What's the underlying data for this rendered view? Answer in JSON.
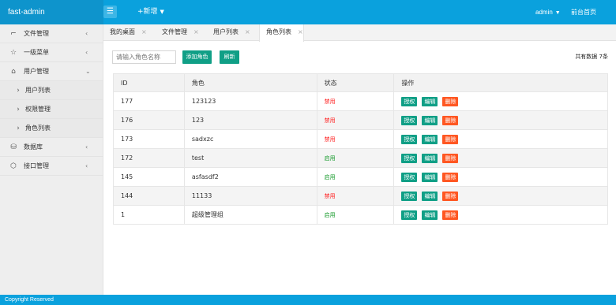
{
  "header": {
    "brand": "fast-admin",
    "menu_icon": "menu-icon",
    "new_label": "+新增",
    "user_label": "admin",
    "home_label": "前台首页"
  },
  "sidebar": {
    "items": [
      {
        "icon": "file-icon",
        "label": "文件管理",
        "arrow": "‹"
      },
      {
        "icon": "star-icon",
        "label": "一级菜单",
        "arrow": "‹"
      },
      {
        "icon": "home-icon",
        "label": "用户管理",
        "arrow": "⌄"
      },
      {
        "icon": "chevron-right-icon",
        "label": "用户列表"
      },
      {
        "icon": "chevron-right-icon",
        "label": "权限管理"
      },
      {
        "icon": "chevron-right-icon",
        "label": "角色列表"
      },
      {
        "icon": "database-icon",
        "label": "数据库",
        "arrow": "‹"
      },
      {
        "icon": "cube-icon",
        "label": "接口管理",
        "arrow": "‹"
      }
    ]
  },
  "tabs": [
    {
      "label": "我的桌面",
      "close": "×"
    },
    {
      "label": "文件管理",
      "close": "×"
    },
    {
      "label": "用户列表",
      "close": "×"
    },
    {
      "label": "角色列表",
      "close": "×"
    }
  ],
  "toolbar": {
    "search_placeholder": "请输入角色名称",
    "add_label": "添加角色",
    "refresh_label": "刷新",
    "total_label": "共有数据 7条"
  },
  "table": {
    "headers": [
      "ID",
      "角色",
      "状态",
      "操作"
    ],
    "rows": [
      {
        "id": "177",
        "role": "123123",
        "status": "禁用",
        "enabled": false
      },
      {
        "id": "176",
        "role": "123",
        "status": "禁用",
        "enabled": false
      },
      {
        "id": "173",
        "role": "sadxzc",
        "status": "禁用",
        "enabled": false
      },
      {
        "id": "172",
        "role": "test",
        "status": "启用",
        "enabled": true
      },
      {
        "id": "145",
        "role": "asfasdf2",
        "status": "启用",
        "enabled": true
      },
      {
        "id": "144",
        "role": "11133",
        "status": "禁用",
        "enabled": false
      },
      {
        "id": "1",
        "role": "超级管理组",
        "status": "启用",
        "enabled": true
      }
    ],
    "actions": {
      "auth": "授权",
      "edit": "编辑",
      "delete": "删除"
    }
  },
  "footer": {
    "text": "Copyright Reserved"
  },
  "colors": {
    "topbar": "#0aa1dd",
    "brand_bg": "#0e94cc",
    "green_button": "#109f86",
    "delete_button": "#ff5722",
    "status_disabled": "#ff2222",
    "status_enabled": "#159a2a"
  }
}
